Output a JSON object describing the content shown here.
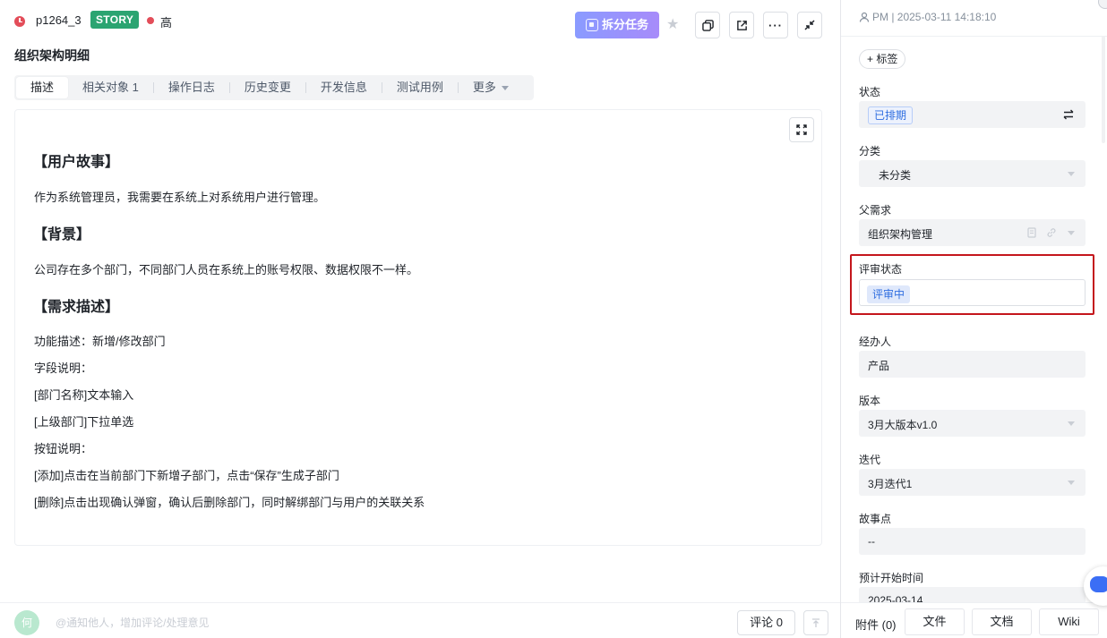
{
  "header": {
    "item_id": "p1264_3",
    "type_badge": "STORY",
    "priority": "高",
    "split_task_label": "拆分任务",
    "more_label": "···"
  },
  "title": "组织架构明细",
  "tabs": [
    {
      "label": "描述",
      "active": true
    },
    {
      "label": "相关对象 1"
    },
    {
      "label": "操作日志"
    },
    {
      "label": "历史变更"
    },
    {
      "label": "开发信息"
    },
    {
      "label": "测试用例"
    },
    {
      "label": "更多"
    }
  ],
  "content": {
    "h1": "【用户故事】",
    "p1": "作为系统管理员，我需要在系统上对系统用户进行管理。",
    "h2": "【背景】",
    "p2": "公司存在多个部门，不同部门人员在系统上的账号权限、数据权限不一样。",
    "h3": "【需求描述】",
    "lines": [
      "功能描述：新增/修改部门",
      "字段说明：",
      "[部门名称]文本输入",
      "[上级部门]下拉单选",
      "按钮说明：",
      "[添加]点击在当前部门下新增子部门，点击“保存”生成子部门",
      "[删除]点击出现确认弹窗，确认后删除部门，同时解绑部门与用户的关联关系"
    ]
  },
  "bottom": {
    "avatar_text": "何",
    "comment_placeholder": "@通知他人，增加评论/处理意见",
    "comment_label": "评论 0"
  },
  "side": {
    "meta": "PM | 2025-03-11 14:18:10",
    "tag_label": "+ 标签",
    "status_label": "状态",
    "status_value": "已排期",
    "category_label": "分类",
    "category_value": "未分类",
    "parent_label": "父需求",
    "parent_value": "组织架构管理",
    "review_label": "评审状态",
    "review_value": "评审中",
    "assignee_label": "经办人",
    "assignee_value": "产品",
    "version_label": "版本",
    "version_value": "3月大版本v1.0",
    "iteration_label": "迭代",
    "iteration_value": "3月迭代1",
    "points_label": "故事点",
    "points_value": "--",
    "start_label": "预计开始时间",
    "start_value": "2025-03-14",
    "attachments_label": "附件 (0)",
    "file_btn": "文件",
    "doc_btn": "文档",
    "wiki_btn": "Wiki"
  },
  "colors": {
    "story_badge": "#2ba471",
    "priority_high": "#e34d59",
    "accent_blue": "#2f6ee0",
    "highlight_border": "#c4161c"
  }
}
